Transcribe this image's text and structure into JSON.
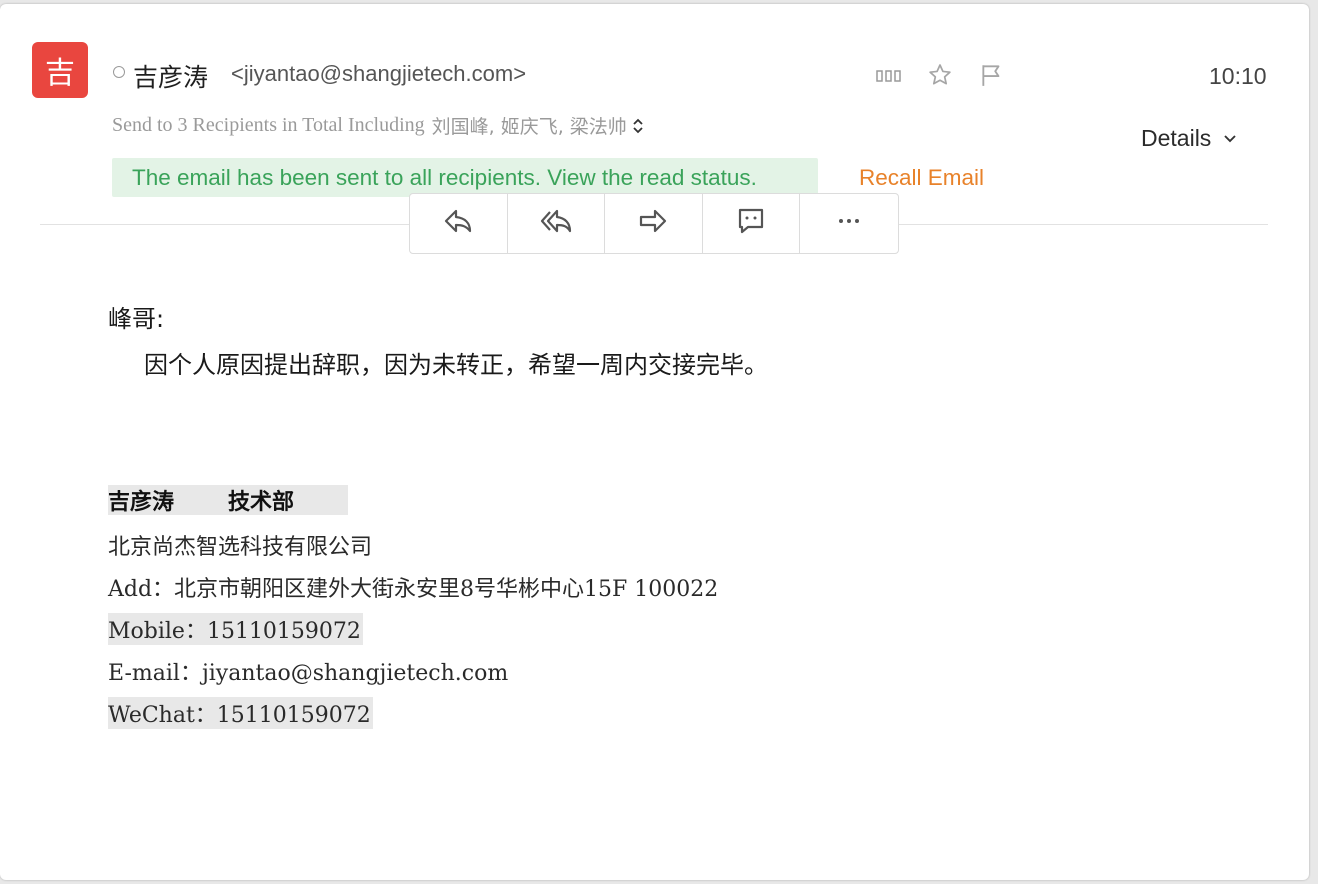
{
  "colors": {
    "avatar_bg": "#e9463f",
    "sent_banner_bg": "#e3f3e6",
    "sent_banner_text": "#3aa35a",
    "recall_text": "#e8822a"
  },
  "header": {
    "avatar_char": "吉",
    "sender_name": "吉彦涛",
    "sender_email": "<jiyantao@shangjietech.com>",
    "time": "10:10",
    "icons": [
      "read-status-icon",
      "star-icon",
      "flag-icon"
    ],
    "recipients_prefix": "Send to 3 Recipients in Total Including",
    "recipients_names": "刘国峰, 姬庆飞, 梁法帅",
    "details_label": "Details"
  },
  "status": {
    "sent_message": "The email has been sent to all recipients. View the read status.",
    "recall_label": "Recall Email"
  },
  "toolbar": {
    "buttons": [
      "reply-icon",
      "reply-all-icon",
      "forward-icon",
      "comment-icon",
      "more-icon"
    ]
  },
  "body": {
    "greeting": "峰哥:",
    "paragraph": "因个人原因提出辞职，因为未转正，希望一周内交接完毕。"
  },
  "signature": {
    "name": "吉彦涛",
    "department": "技术部",
    "company": "北京尚杰智选科技有限公司",
    "address": "Add：北京市朝阳区建外大街永安里8号华彬中心15F   100022",
    "mobile": "Mobile：15110159072",
    "email": "E-mail：jiyantao@shangjietech.com",
    "wechat": "WeChat：15110159072"
  }
}
